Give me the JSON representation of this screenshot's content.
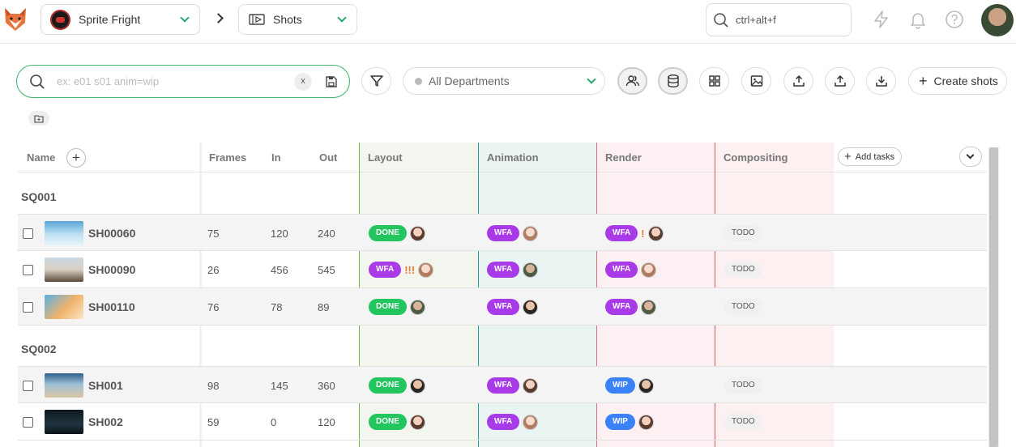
{
  "topbar": {
    "production": "Sprite Fright",
    "section": "Shots",
    "search_placeholder": "ctrl+alt+f"
  },
  "filters": {
    "search_placeholder": "ex: e01 s01 anim=wip",
    "clear_label": "x",
    "department": "All Departments",
    "create_label": "Create shots"
  },
  "columns": {
    "name": "Name",
    "frames": "Frames",
    "in": "In",
    "out": "Out",
    "tasks": [
      "Layout",
      "Animation",
      "Render",
      "Compositing"
    ],
    "add_tasks": "Add tasks"
  },
  "colors": {
    "done": "#22c55e",
    "wfa": "#a93ae8",
    "wip": "#3b82f6",
    "layout_bg": "#f3f6ee",
    "animation_bg": "#e9f4f3",
    "render_bg": "#fdf0f2",
    "compositing_bg": "#fdf0f0"
  },
  "sequences": [
    {
      "name": "SQ001",
      "shots": [
        {
          "name": "SH00060",
          "frames": "75",
          "in": "120",
          "out": "240",
          "layout": {
            "status": "DONE",
            "priority": ""
          },
          "animation": {
            "status": "WFA",
            "priority": ""
          },
          "render": {
            "status": "WFA",
            "priority": "!"
          },
          "compositing": "TODO"
        },
        {
          "name": "SH00090",
          "frames": "26",
          "in": "456",
          "out": "545",
          "layout": {
            "status": "WFA",
            "priority": "!!!"
          },
          "animation": {
            "status": "WFA",
            "priority": ""
          },
          "render": {
            "status": "WFA",
            "priority": ""
          },
          "compositing": "TODO"
        },
        {
          "name": "SH00110",
          "frames": "76",
          "in": "78",
          "out": "89",
          "layout": {
            "status": "DONE",
            "priority": ""
          },
          "animation": {
            "status": "WFA",
            "priority": ""
          },
          "render": {
            "status": "WFA",
            "priority": ""
          },
          "compositing": "TODO"
        }
      ]
    },
    {
      "name": "SQ002",
      "shots": [
        {
          "name": "SH001",
          "frames": "98",
          "in": "145",
          "out": "360",
          "layout": {
            "status": "DONE",
            "priority": ""
          },
          "animation": {
            "status": "WFA",
            "priority": ""
          },
          "render": {
            "status": "WIP",
            "priority": ""
          },
          "compositing": "TODO"
        },
        {
          "name": "SH002",
          "frames": "59",
          "in": "0",
          "out": "120",
          "layout": {
            "status": "DONE",
            "priority": ""
          },
          "animation": {
            "status": "WFA",
            "priority": ""
          },
          "render": {
            "status": "WIP",
            "priority": ""
          },
          "compositing": "TODO"
        }
      ]
    }
  ]
}
